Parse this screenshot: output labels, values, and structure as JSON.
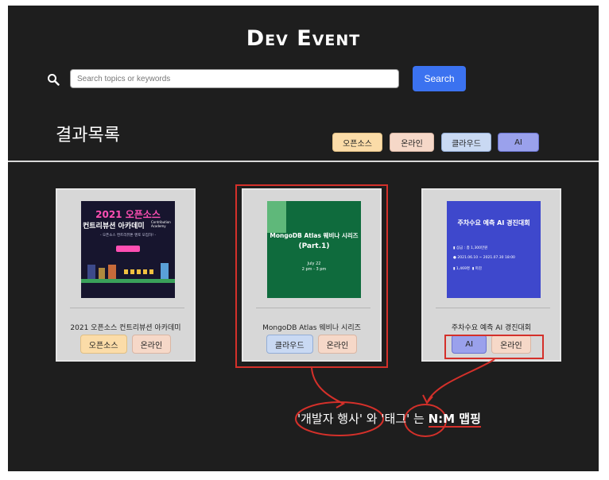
{
  "header": {
    "logo": "Dev Event"
  },
  "search": {
    "placeholder": "Search topics or keywords",
    "button_label": "Search"
  },
  "results": {
    "heading": "결과목록"
  },
  "filter_chips": [
    {
      "label": "오픈소스"
    },
    {
      "label": "온라인"
    },
    {
      "label": "클라우드"
    },
    {
      "label": "AI"
    }
  ],
  "cards": [
    {
      "title": "2021 오픈소스 컨트리뷰션 아카데미",
      "thumb": {
        "line1": "2021 오픈소스",
        "line2": "컨트리뷰션 아카데미",
        "sub": "Contribution Academy",
        "tagline": "- 오픈소스 컨트리뷰톤 멘토 모집하! -"
      },
      "tags": [
        "오픈소스",
        "온라인"
      ]
    },
    {
      "title": "MongoDB Atlas 웨비나 시리즈",
      "thumb": {
        "line1": "MongoDB Atlas 웨비나 시리즈",
        "line2": "(Part.1)",
        "date": "July 22",
        "time": "2 pm - 3 pm"
      },
      "tags": [
        "클라우드",
        "온라인"
      ]
    },
    {
      "title": "주차수요 예측 AI 경진대회",
      "thumb": {
        "headline": "주차수요 예측 AI 경진대회",
        "prize": "상금 : 총 1,300만원",
        "period": "2021.06.10 ~ 2021.07.30 18:00",
        "participants": "1,469명",
        "status": "마감"
      },
      "tags": [
        "AI",
        "온라인"
      ]
    }
  ],
  "annotation": {
    "part1": "'개발자 행사'",
    "part2": " 와 ",
    "part3": "'태그'",
    "part4": " 는 ",
    "part5": "N:M 맵핑"
  },
  "colors": {
    "background": "#1e1e1e",
    "accent": "#3b72f0",
    "highlight": "#d4302a"
  }
}
